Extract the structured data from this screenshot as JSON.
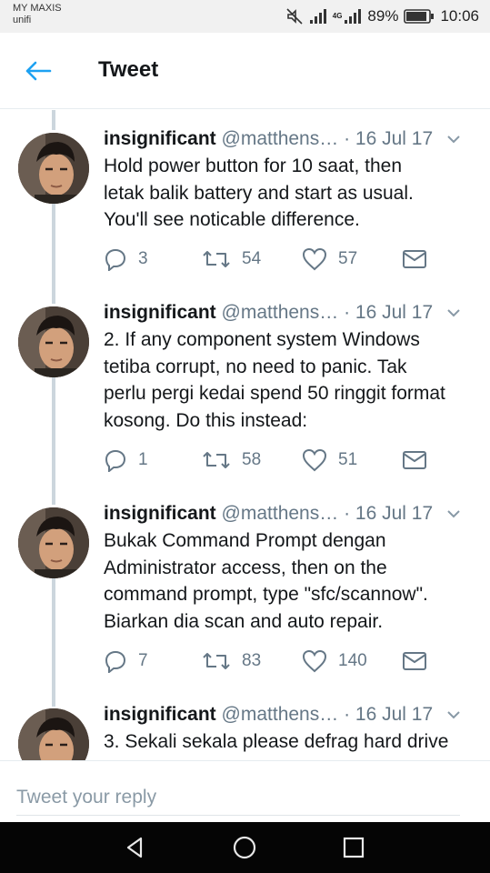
{
  "status_bar": {
    "carrier_line1": "MY MAXIS",
    "carrier_line2": "unifi",
    "network_type": "4G",
    "battery": "89%",
    "time": "10:06"
  },
  "header": {
    "title": "Tweet",
    "back_icon": "arrow-left-icon"
  },
  "tweets": [
    {
      "name": "insignificant",
      "handle": "@matthens…",
      "date": "· 16 Jul 17",
      "lines": [
        "Hold power button for 10 saat, then",
        "letak balik battery and start as usual.",
        "You'll see noticable difference."
      ],
      "replies": "3",
      "retweets": "54",
      "likes": "57"
    },
    {
      "name": "insignificant",
      "handle": "@matthens…",
      "date": "· 16 Jul 17",
      "lines": [
        "2. If any component system Windows",
        "tetiba corrupt, no need to panic. Tak",
        "perlu pergi kedai spend 50 ringgit format",
        "kosong. Do this instead:"
      ],
      "replies": "1",
      "retweets": "58",
      "likes": "51"
    },
    {
      "name": "insignificant",
      "handle": "@matthens…",
      "date": "· 16 Jul 17",
      "lines": [
        "Bukak Command Prompt dengan",
        "Administrator access, then on the",
        "command prompt, type \"sfc/scannow\".",
        "Biarkan dia scan and auto repair."
      ],
      "replies": "7",
      "retweets": "83",
      "likes": "140"
    },
    {
      "name": "insignificant",
      "handle": "@matthens…",
      "date": "· 16 Jul 17",
      "lines": [
        "3. Sekali sekala please defrag hard drive"
      ]
    }
  ],
  "reply": {
    "placeholder": "Tweet your reply"
  },
  "colors": {
    "accent": "#1da1f2",
    "muted": "#657786",
    "thread_line": "#ccd6dd",
    "status_bar_bg": "#f1f1f1",
    "nav_bar_bg": "#050505"
  },
  "icons": {
    "reply": "reply-icon",
    "retweet": "retweet-icon",
    "like": "heart-icon",
    "dm": "envelope-icon",
    "caret": "chevron-down-icon",
    "nav_back": "triangle-back-icon",
    "nav_home": "circle-home-icon",
    "nav_recent": "square-recent-icon"
  }
}
